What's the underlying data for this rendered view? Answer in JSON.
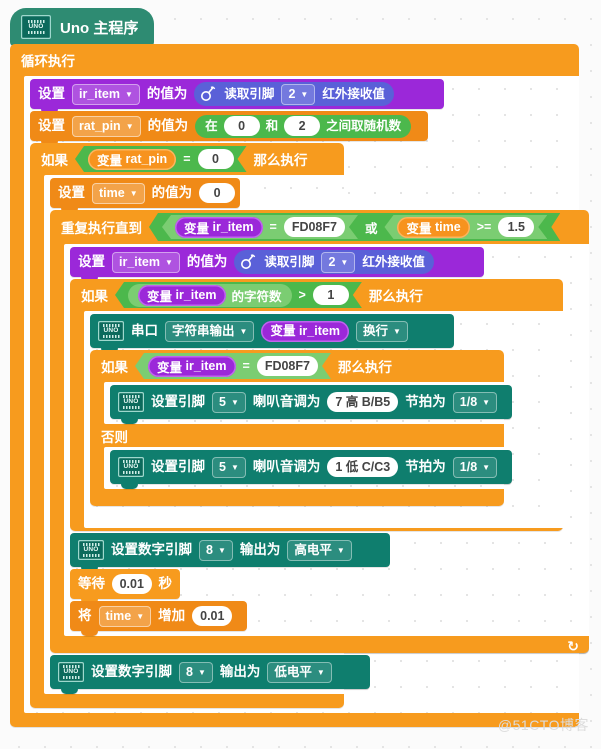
{
  "watermark": "@51CTO博客",
  "hat": {
    "label": "Uno 主程序",
    "icon": "uno-board-icon"
  },
  "forever": {
    "label": "循环执行",
    "loop_icon": "loop-arrow-icon"
  },
  "set_ir_item": {
    "verb": "设置",
    "variable": "ir_item",
    "of_value": "的值为",
    "sensor": {
      "icon": "ir-receiver-icon",
      "label": "读取引脚",
      "pin": "2",
      "suffix": "红外接收值"
    }
  },
  "set_rat_pin": {
    "verb": "设置",
    "variable": "rat_pin",
    "of_value": "的值为",
    "random": {
      "prefix": "在",
      "low": "0",
      "mid": "和",
      "high": "2",
      "suffix": "之间取随机数"
    }
  },
  "if_rat_pin": {
    "if_label": "如果",
    "then_label": "那么执行",
    "condition": {
      "var_prefix": "变量",
      "var_name": "rat_pin",
      "operator": "=",
      "value": "0"
    }
  },
  "set_time": {
    "verb": "设置",
    "variable": "time",
    "of_value": "的值为",
    "value": "0"
  },
  "repeat_until": {
    "label": "重复执行直到",
    "left": {
      "var_prefix": "变量",
      "var_name": "ir_item",
      "operator": "=",
      "value": "FD08F7"
    },
    "joiner": "或",
    "right": {
      "var_prefix": "变量",
      "var_name": "time",
      "operator": ">=",
      "value": "1.5"
    }
  },
  "set_ir_item2": {
    "verb": "设置",
    "variable": "ir_item",
    "of_value": "的值为",
    "sensor": {
      "icon": "ir-receiver-icon",
      "label": "读取引脚",
      "pin": "2",
      "suffix": "红外接收值"
    }
  },
  "if_length": {
    "if_label": "如果",
    "then_label": "那么执行",
    "condition": {
      "var_prefix": "变量",
      "var_name": "ir_item",
      "length_label": "的字符数",
      "operator": ">",
      "value": "1"
    }
  },
  "serial_print": {
    "icon": "uno-board-icon",
    "port": "串口",
    "mode": "字符串输出",
    "variable": {
      "var_prefix": "变量",
      "var_name": "ir_item"
    },
    "newline": "换行"
  },
  "if_else_ir": {
    "if_label": "如果",
    "then_label": "那么执行",
    "else_label": "否则",
    "condition": {
      "var_prefix": "变量",
      "var_name": "ir_item",
      "operator": "=",
      "value": "FD08F7"
    },
    "tone_then": {
      "icon": "uno-board-icon",
      "label": "设置引脚",
      "pin": "5",
      "mid": "喇叭音调为",
      "note": "7 高 B/B5",
      "beat_label": "节拍为",
      "beat": "1/8"
    },
    "tone_else": {
      "icon": "uno-board-icon",
      "label": "设置引脚",
      "pin": "5",
      "mid": "喇叭音调为",
      "note": "1 低 C/C3",
      "beat_label": "节拍为",
      "beat": "1/8"
    }
  },
  "digital_high": {
    "icon": "uno-board-icon",
    "label": "设置数字引脚",
    "pin": "8",
    "mid": "输出为",
    "level": "高电平"
  },
  "wait": {
    "prefix": "等待",
    "value": "0.01",
    "suffix": "秒"
  },
  "change_time": {
    "prefix": "将",
    "variable": "time",
    "mid": "增加",
    "value": "0.01"
  },
  "digital_low": {
    "icon": "uno-board-icon",
    "label": "设置数字引脚",
    "pin": "8",
    "mid": "输出为",
    "level": "低电平"
  },
  "colors": {
    "hat": "#2e8b72",
    "control": "#f79b1e",
    "variable": "#f7931e",
    "variable_purple": "#9b28d9",
    "operator": "#4cb84c",
    "arduino": "#0f7e6e",
    "sensor": "#5a60d8",
    "background": "#fbfbfb"
  }
}
